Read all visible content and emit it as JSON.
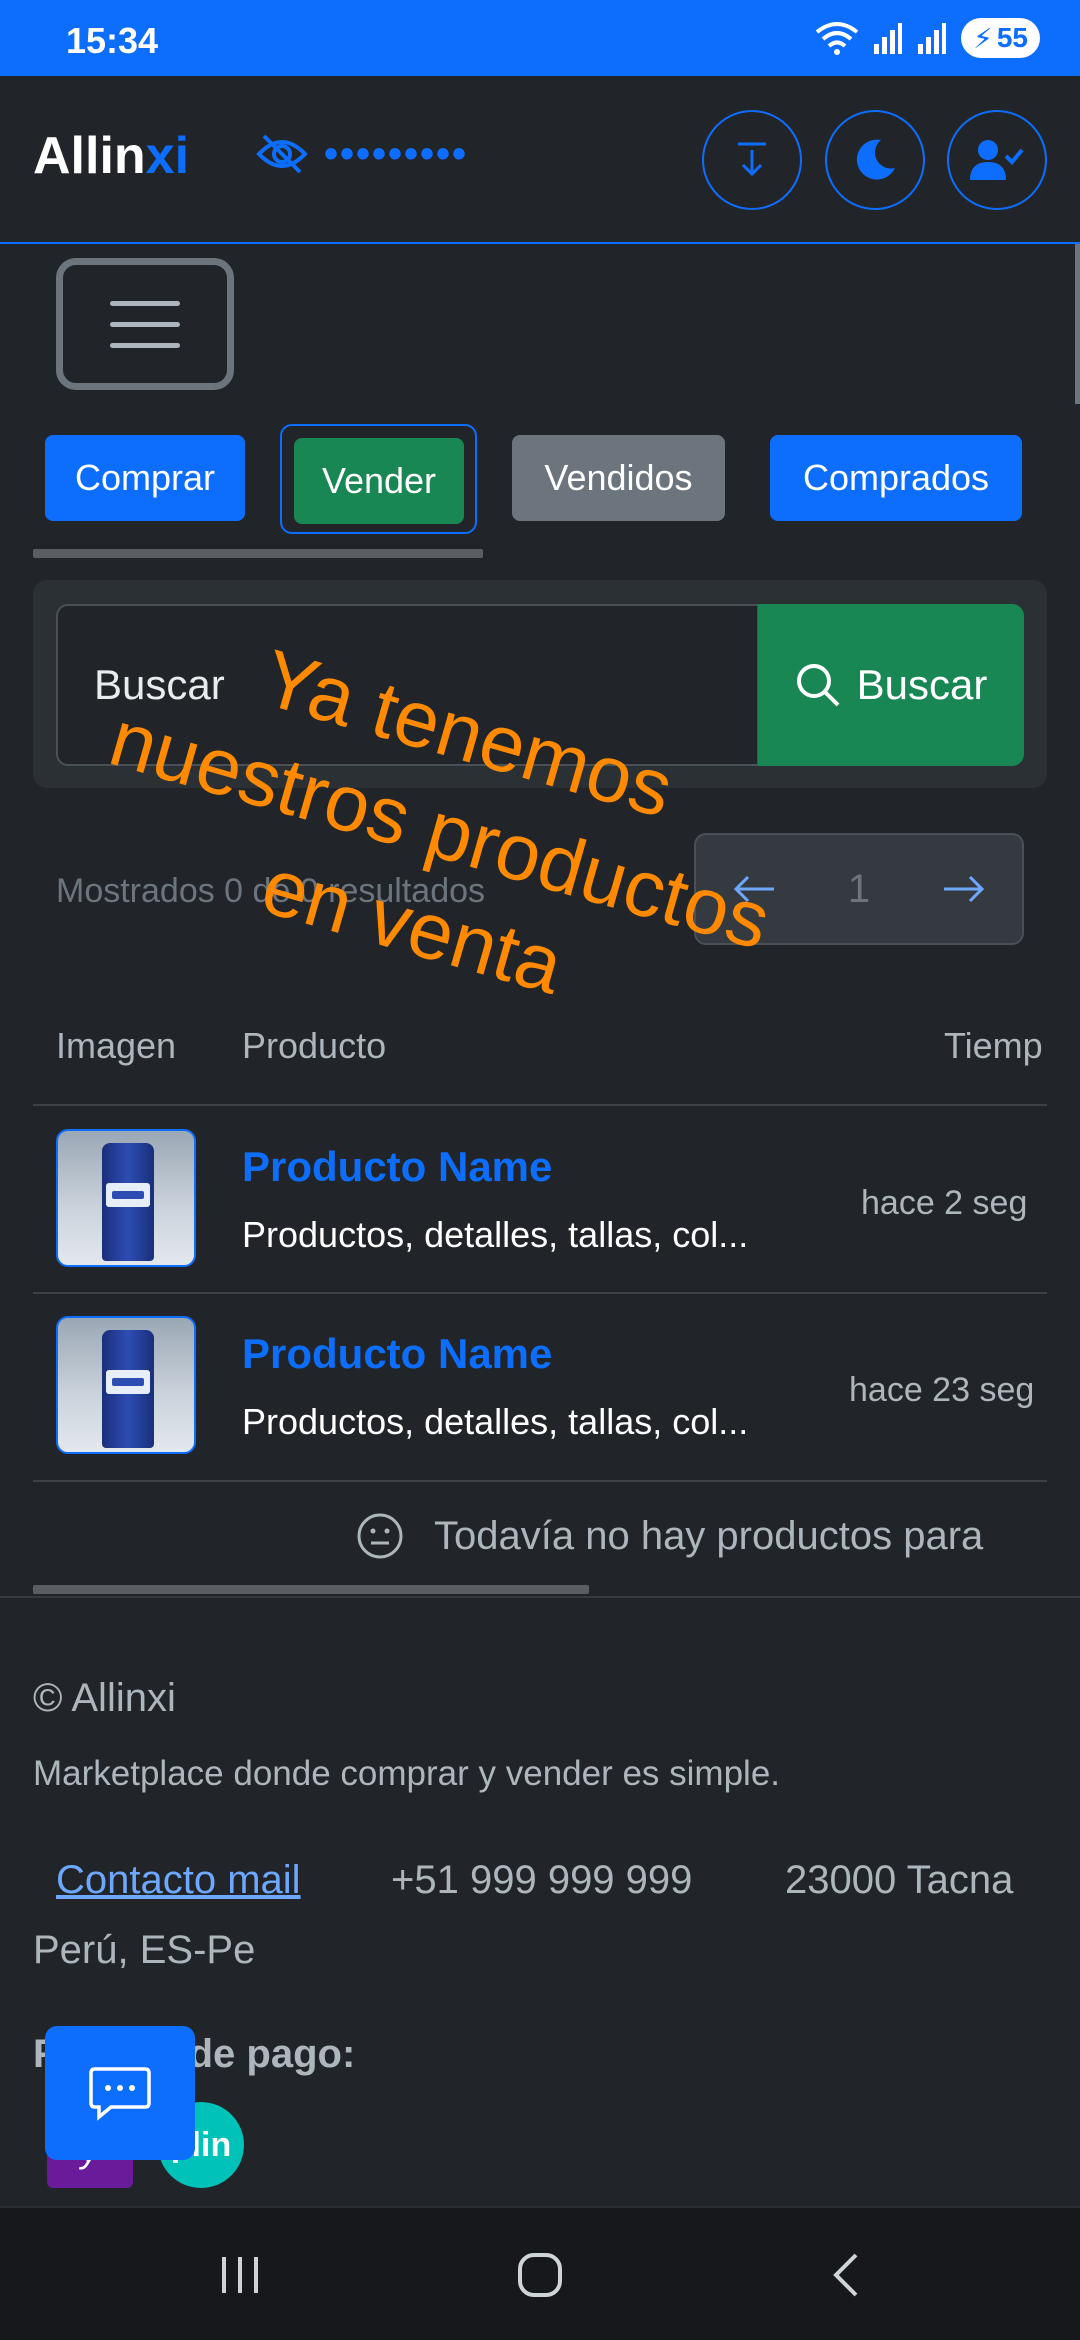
{
  "status_bar": {
    "time": "15:34",
    "battery": "55",
    "icons": [
      "wifi-icon",
      "signal-icon",
      "signal-icon",
      "battery-icon"
    ]
  },
  "header": {
    "brand_main": "Allin",
    "brand_accent": "xi",
    "hidden_value": "•••••••••",
    "icons": [
      "eye-slash-icon",
      "download-icon",
      "moon-icon",
      "user-check-icon"
    ]
  },
  "tabs": [
    {
      "label": "Comprar"
    },
    {
      "label": "Vender"
    },
    {
      "label": "Vendidos"
    },
    {
      "label": "Comprados"
    }
  ],
  "search": {
    "placeholder": "Buscar",
    "button_label": "Buscar"
  },
  "results": {
    "text": "Mostrados 0 de 0 resultados"
  },
  "pager": {
    "page": "1"
  },
  "table": {
    "headers": [
      "Imagen",
      "Producto",
      "Tiemp"
    ],
    "rows": [
      {
        "name": "Producto Name",
        "desc": "Productos, detalles, tallas, col...",
        "time": "hace 2 seg"
      },
      {
        "name": "Producto Name",
        "desc": "Productos, detalles, tallas, col...",
        "time": "hace 23 seg"
      }
    ],
    "empty_message": "Todavía no hay productos para"
  },
  "overlay": {
    "line1": "Ya tenemos",
    "line2": "nuestros productos",
    "line3": "en venta"
  },
  "footer": {
    "copyright": "© Allinxi",
    "tagline": "Marketplace donde comprar y vender es simple.",
    "contact_link": "Contacto mail",
    "phone": "+51 999 999 999",
    "address_line1": "23000 Tacna",
    "address_line2": "Perú, ES-Pe",
    "payment_title": "Formas de pago:",
    "payment_methods": [
      "yape",
      "plin"
    ]
  },
  "colors": {
    "primary": "#0d6efd",
    "success": "#198754",
    "secondary": "#6c757d",
    "overlay": "#ff8a00",
    "background": "#212529"
  }
}
